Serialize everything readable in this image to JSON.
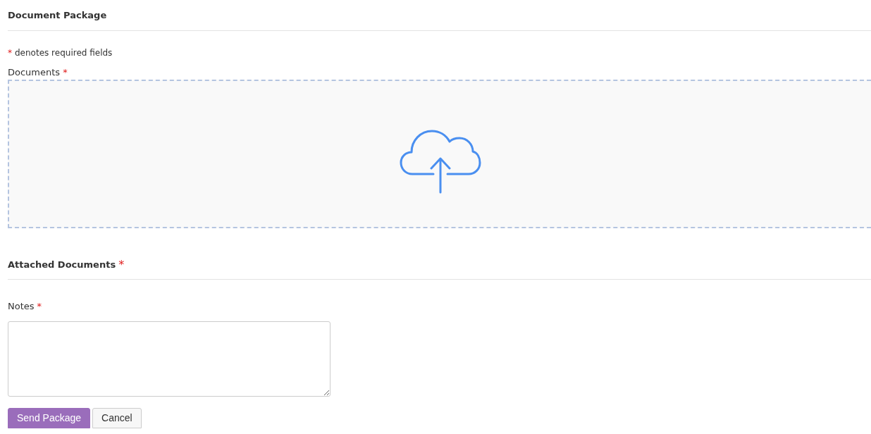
{
  "section_title": "Document Package",
  "required_note": {
    "marker": "*",
    "text": "denotes required fields"
  },
  "documents_field": {
    "label": "Documents",
    "marker": "*"
  },
  "attached_section": {
    "title": "Attached Documents",
    "marker": "*"
  },
  "notes_field": {
    "label": "Notes",
    "marker": "*"
  },
  "buttons": [
    {
      "label": "Send Package",
      "kind": "primary"
    },
    {
      "label": "Cancel",
      "kind": "secondary"
    }
  ]
}
